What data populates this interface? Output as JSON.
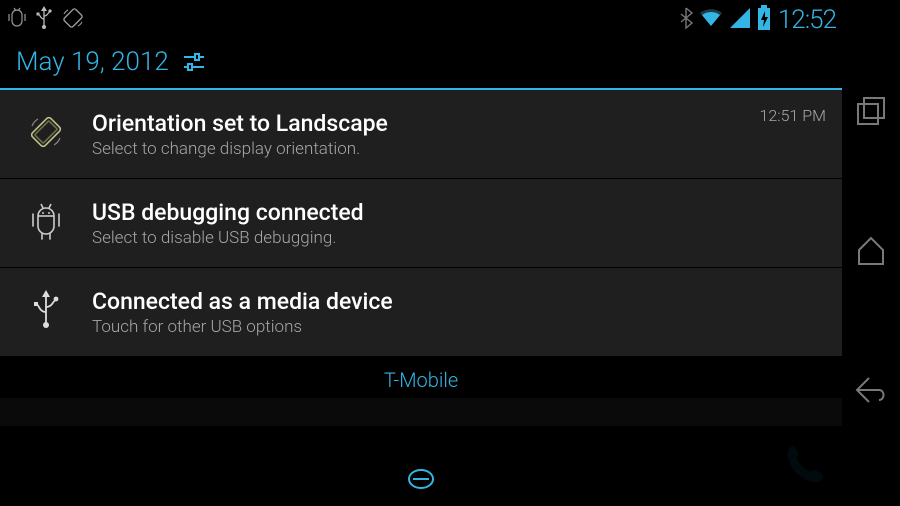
{
  "status": {
    "clock": "12:52",
    "left_icons": [
      "adb-icon",
      "usb-icon",
      "rotation-lock-icon"
    ],
    "right_icons": [
      "bluetooth-icon",
      "wifi-icon",
      "signal-icon",
      "battery-charging-icon"
    ]
  },
  "shade": {
    "date": "May 19, 2012",
    "carrier": "T-Mobile"
  },
  "notifications": [
    {
      "icon": "rotation-lock-icon",
      "title": "Orientation set to Landscape",
      "subtitle": "Select to change display orientation.",
      "time": "12:51 PM",
      "pinned": true
    },
    {
      "icon": "adb-icon",
      "title": "USB debugging connected",
      "subtitle": "Select to disable USB debugging.",
      "time": "",
      "pinned": true
    },
    {
      "icon": "usb-icon",
      "title": "Connected as a media device",
      "subtitle": "Touch for other USB options",
      "time": "",
      "pinned": true
    }
  ]
}
